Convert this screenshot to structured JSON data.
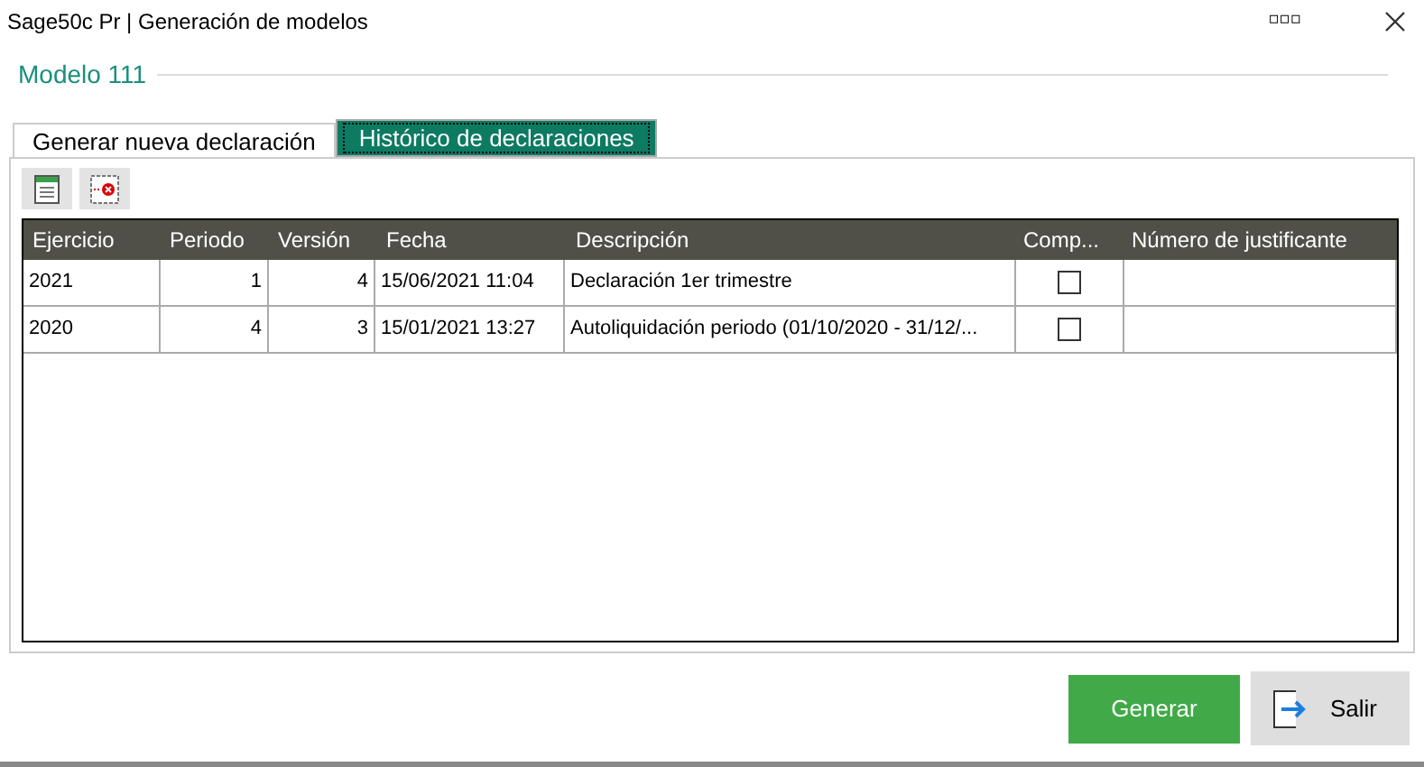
{
  "window": {
    "title": "Sage50c Pr | Generación de modelos",
    "more": "▫▫▫"
  },
  "section": {
    "title": "Modelo 111"
  },
  "tabs": [
    {
      "label": "Generar nueva declaración",
      "selected": false
    },
    {
      "label": "Histórico de declaraciones",
      "selected": true
    }
  ],
  "table": {
    "columns": [
      "Ejercicio",
      "Periodo",
      "Versión",
      "Fecha",
      "Descripción",
      "Comp...",
      "Número de justificante"
    ],
    "rows": [
      {
        "ejercicio": "2021",
        "periodo": "1",
        "version": "4",
        "fecha": "15/06/2021 11:04",
        "descripcion": "Declaración 1er trimestre",
        "checked": false,
        "justificante": ""
      },
      {
        "ejercicio": "2020",
        "periodo": "4",
        "version": "3",
        "fecha": "15/01/2021 13:27",
        "descripcion": "Autoliquidación periodo (01/10/2020 - 31/12/...",
        "checked": false,
        "justificante": ""
      }
    ]
  },
  "buttons": [
    {
      "kind": "primary",
      "label": "Generar"
    },
    {
      "kind": "exit",
      "label": "Salir"
    }
  ]
}
